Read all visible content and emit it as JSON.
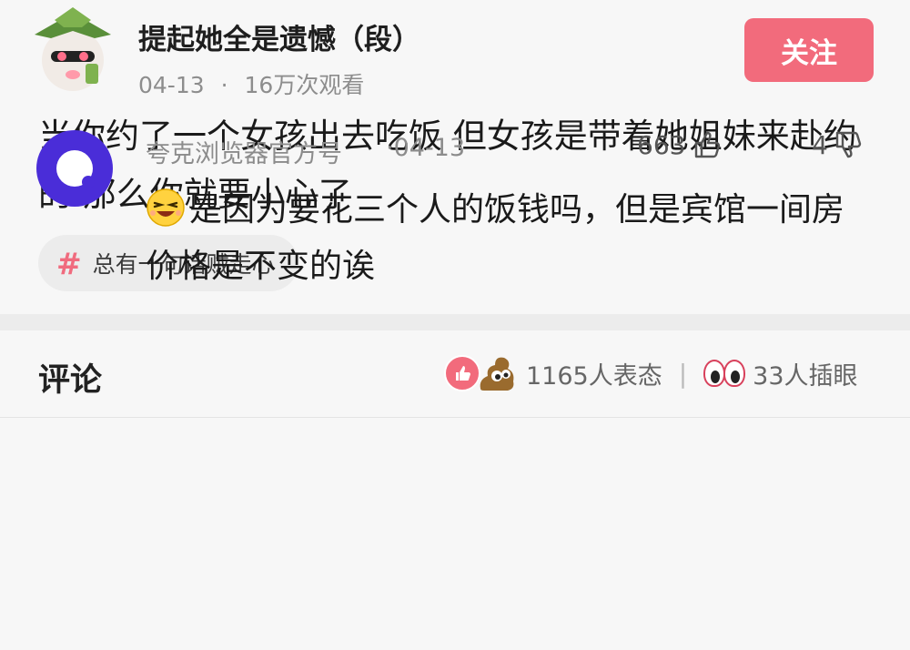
{
  "post": {
    "author": "提起她全是遗憾（段）",
    "date": "04-13",
    "meta_sep": "·",
    "views": "16万次观看",
    "follow_label": "关注",
    "content": "当你约了一个女孩出去吃饭 但女孩是带着她姐妹来赴约的 那么你就要小心了",
    "topic_hash": "#",
    "topic": "总有一句话贼走心",
    "avatar_caption": "嘻 嘻"
  },
  "comments_header": {
    "title": "评论",
    "reactions": "1165人表态",
    "separator": "|",
    "eyes_count": "33人插眼"
  },
  "comment": {
    "author": "夸克浏览器官方号",
    "date": "·04-13",
    "likes": "663",
    "dislikes": "4",
    "text": "是因为要花三个人的饭钱吗，但是宾馆一间房价格是不变的诶"
  },
  "colors": {
    "accent": "#f26b7c",
    "quark_purple": "#4a2dd8"
  }
}
